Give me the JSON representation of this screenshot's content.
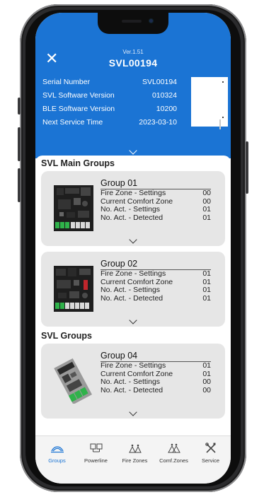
{
  "header": {
    "version": "Ver.1.51",
    "serial_title": "SVL00194",
    "info": [
      {
        "label": "Serial Number",
        "value": "SVL00194"
      },
      {
        "label": "SVL Software Version",
        "value": "010324"
      },
      {
        "label": "BLE Software Version",
        "value": "10200"
      },
      {
        "label": "Next Service Time",
        "value": "2023-03-10"
      }
    ]
  },
  "sections": {
    "main_groups_title": "SVL Main Groups",
    "groups_title": "SVL Groups"
  },
  "cards": [
    {
      "title": "Group 01",
      "rows": [
        {
          "label": "Fire Zone - Settings",
          "value": "00"
        },
        {
          "label": "Current Comfort Zone",
          "value": "00"
        },
        {
          "label": "No. Act. - Settings",
          "value": "01"
        },
        {
          "label": "No. Act. - Detected",
          "value": "01"
        }
      ]
    },
    {
      "title": "Group 02",
      "rows": [
        {
          "label": "Fire Zone - Settings",
          "value": "01"
        },
        {
          "label": "Current Comfort Zone",
          "value": "01"
        },
        {
          "label": "No. Act. - Settings",
          "value": "01"
        },
        {
          "label": "No. Act. - Detected",
          "value": "01"
        }
      ]
    },
    {
      "title": "Group 04",
      "rows": [
        {
          "label": "Fire Zone - Settings",
          "value": "01"
        },
        {
          "label": "Current Comfort Zone",
          "value": "01"
        },
        {
          "label": "No. Act. - Settings",
          "value": "00"
        },
        {
          "label": "No. Act. - Detected",
          "value": "00"
        }
      ]
    }
  ],
  "tabs": [
    {
      "label": "Groups",
      "icon": "groups-icon",
      "active": true
    },
    {
      "label": "Powerline",
      "icon": "powerline-icon",
      "active": false
    },
    {
      "label": "Fire Zones",
      "icon": "fire-zones-icon",
      "active": false
    },
    {
      "label": "Comf.Zones",
      "icon": "comfort-zones-icon",
      "active": false
    },
    {
      "label": "Service",
      "icon": "service-tools-icon",
      "active": false
    }
  ],
  "colors": {
    "accent": "#1b74d4",
    "card_bg": "#e6e6e6",
    "tabbar_bg": "#f4f4f4"
  }
}
